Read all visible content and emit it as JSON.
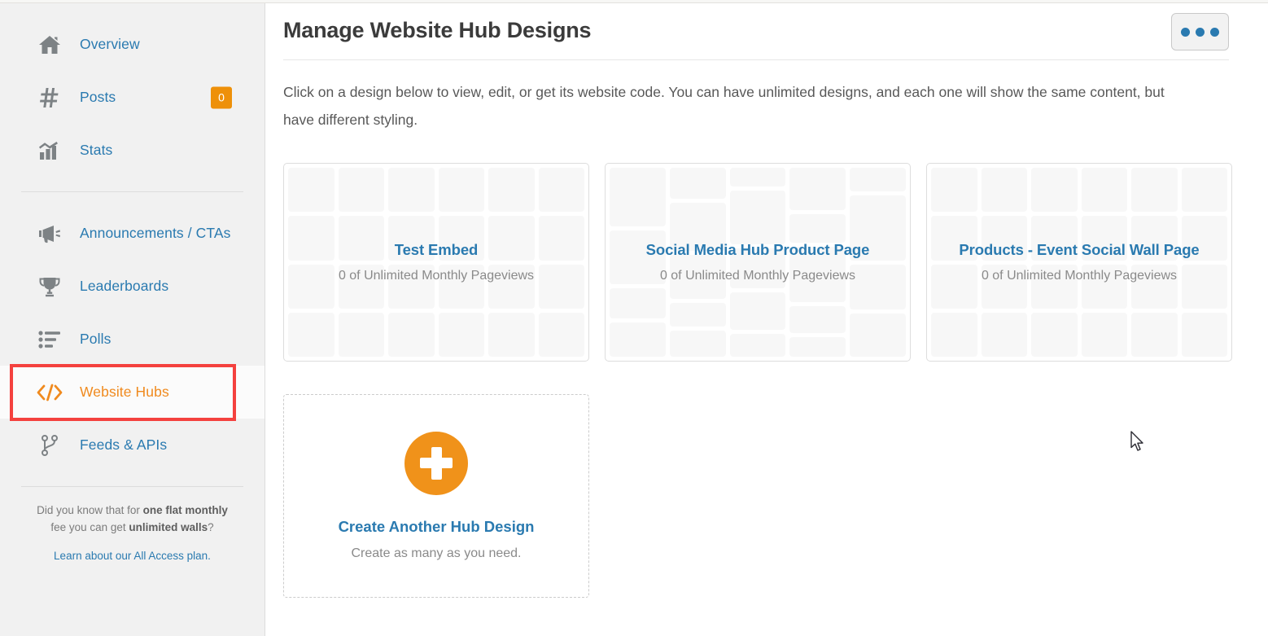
{
  "sidebar": {
    "primary_items": [
      {
        "id": "overview",
        "label": "Overview",
        "icon": "home-icon",
        "badge": null
      },
      {
        "id": "posts",
        "label": "Posts",
        "icon": "hashtag-icon",
        "badge": "0"
      },
      {
        "id": "stats",
        "label": "Stats",
        "icon": "bar-chart-icon",
        "badge": null
      }
    ],
    "secondary_items": [
      {
        "id": "announcements",
        "label": "Announcements / CTAs",
        "icon": "megaphone-icon",
        "badge": null,
        "active": false
      },
      {
        "id": "leaderboards",
        "label": "Leaderboards",
        "icon": "trophy-icon",
        "badge": null,
        "active": false
      },
      {
        "id": "polls",
        "label": "Polls",
        "icon": "list-icon",
        "badge": null,
        "active": false
      },
      {
        "id": "website-hubs",
        "label": "Website Hubs",
        "icon": "code-brackets-icon",
        "badge": null,
        "active": true
      },
      {
        "id": "feeds-apis",
        "label": "Feeds & APIs",
        "icon": "code-branch-icon",
        "badge": null,
        "active": false
      }
    ],
    "promo": {
      "line_1": "Did you know that for ",
      "bold_1": "one flat monthly",
      "line_2": " fee you can get ",
      "bold_2": "unlimited walls",
      "line_3": "?",
      "link": "Learn about our All Access plan."
    }
  },
  "header": {
    "title": "Manage Website Hub Designs",
    "more_button_label": "•••"
  },
  "main": {
    "intro": "Click on a design below to view, edit, or get its website code. You can have unlimited designs, and each one will show the same content, but have different styling.",
    "designs": [
      {
        "title": "Test Embed",
        "subtitle": "0 of Unlimited Monthly Pageviews",
        "pattern": "grid"
      },
      {
        "title": "Social Media Hub Product Page",
        "subtitle": "0 of Unlimited Monthly Pageviews",
        "pattern": "masonry"
      },
      {
        "title": "Products - Event Social Wall Page",
        "subtitle": "0 of Unlimited Monthly Pageviews",
        "pattern": "grid"
      }
    ],
    "create_card": {
      "title": "Create Another Hub Design",
      "subtitle": "Create as many as you need.",
      "icon": "plus-circle-icon"
    }
  },
  "colors": {
    "accent_orange": "#f0921a",
    "link_blue": "#2a7ab0",
    "badge_orange": "#ee9009",
    "highlight_red": "#f4413e",
    "sidebar_bg": "#f1f1f1",
    "tile_gray": "#f7f7f7"
  }
}
